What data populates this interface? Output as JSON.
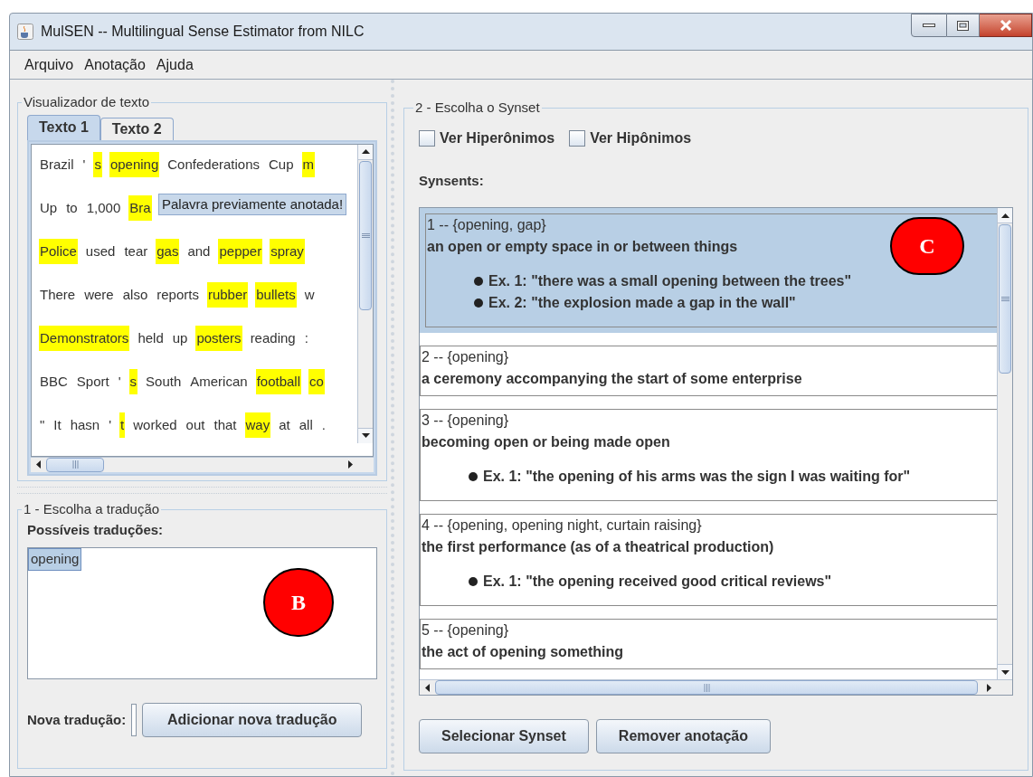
{
  "window": {
    "title": "MulSEN -- Multilingual Sense Estimator from NILC"
  },
  "menu": [
    "Arquivo",
    "Anotação",
    "Ajuda"
  ],
  "text_viewer": {
    "title": "Visualizador de texto",
    "tabs": [
      {
        "label": "Texto 1",
        "selected": true
      },
      {
        "label": "Texto 2",
        "selected": false
      }
    ],
    "lines": [
      {
        "tokens": [
          {
            "text": "Brazil",
            "highlighted": false
          },
          {
            "text": "'",
            "highlighted": false
          },
          {
            "text": "s",
            "highlighted": true
          },
          {
            "text": "opening",
            "highlighted": true
          },
          {
            "text": "Confederations",
            "highlighted": false
          },
          {
            "text": "Cup",
            "highlighted": false
          },
          {
            "text": "m",
            "highlighted": true
          }
        ]
      },
      {
        "tokens": [
          {
            "text": "Up",
            "highlighted": false
          },
          {
            "text": "to",
            "highlighted": false
          },
          {
            "text": "1,000",
            "highlighted": false
          },
          {
            "text": "Bra",
            "highlighted": true
          }
        ]
      },
      {
        "tokens": [
          {
            "text": "Police",
            "highlighted": true
          },
          {
            "text": "used",
            "highlighted": false
          },
          {
            "text": "tear",
            "highlighted": false
          },
          {
            "text": "gas",
            "highlighted": true
          },
          {
            "text": "and",
            "highlighted": false
          },
          {
            "text": "pepper",
            "highlighted": true
          },
          {
            "text": "spray",
            "highlighted": true
          }
        ]
      },
      {
        "tokens": [
          {
            "text": "There",
            "highlighted": false
          },
          {
            "text": "were",
            "highlighted": false
          },
          {
            "text": "also",
            "highlighted": false
          },
          {
            "text": "reports",
            "highlighted": false
          },
          {
            "text": "rubber",
            "highlighted": true
          },
          {
            "text": "bullets",
            "highlighted": true
          },
          {
            "text": "w",
            "highlighted": false
          }
        ]
      },
      {
        "tokens": [
          {
            "text": "Demonstrators",
            "highlighted": true
          },
          {
            "text": "held",
            "highlighted": false
          },
          {
            "text": "up",
            "highlighted": false
          },
          {
            "text": "posters",
            "highlighted": true
          },
          {
            "text": "reading",
            "highlighted": false
          },
          {
            "text": ":",
            "highlighted": false
          }
        ]
      },
      {
        "tokens": [
          {
            "text": "BBC",
            "highlighted": false
          },
          {
            "text": "Sport",
            "highlighted": false
          },
          {
            "text": "'",
            "highlighted": false
          },
          {
            "text": "s",
            "highlighted": true
          },
          {
            "text": "South",
            "highlighted": false
          },
          {
            "text": "American",
            "highlighted": false
          },
          {
            "text": "football",
            "highlighted": true
          },
          {
            "text": "co",
            "highlighted": true
          }
        ]
      },
      {
        "tokens": [
          {
            "text": "\"",
            "highlighted": false
          },
          {
            "text": "It",
            "highlighted": false
          },
          {
            "text": "hasn",
            "highlighted": false
          },
          {
            "text": "'",
            "highlighted": false
          },
          {
            "text": "t",
            "highlighted": true
          },
          {
            "text": "worked",
            "highlighted": false
          },
          {
            "text": "out",
            "highlighted": false
          },
          {
            "text": "that",
            "highlighted": false
          },
          {
            "text": "way",
            "highlighted": true
          },
          {
            "text": "at",
            "highlighted": false
          },
          {
            "text": "all",
            "highlighted": false
          },
          {
            "text": ".",
            "highlighted": false
          }
        ]
      }
    ],
    "tooltip": "Palavra previamente anotada!"
  },
  "translation": {
    "title": "1 - Escolha a tradução",
    "list_label": "Possíveis traduções:",
    "items": [
      {
        "text": "opening",
        "selected": true
      }
    ],
    "marker": "B",
    "new_label": "Nova tradução:",
    "add_button": "Adicionar nova tradução"
  },
  "synset": {
    "title": "2 - Escolha o Synset",
    "checkboxes": [
      {
        "label": "Ver Hiperônimos",
        "checked": false
      },
      {
        "label": "Ver Hipônimos",
        "checked": false
      }
    ],
    "list_label": "Synsents:",
    "marker": "C",
    "items": [
      {
        "header": "1 -- {opening, gap}",
        "gloss": "an open or empty space in or between things",
        "examples": [
          "Ex. 1: \"there was a small opening between the trees\"",
          "Ex. 2: \"the explosion made a gap in the wall\""
        ],
        "selected": true
      },
      {
        "header": "2 -- {opening}",
        "gloss": "a ceremony accompanying the start of some enterprise",
        "selected": false
      },
      {
        "header": "3 -- {opening}",
        "gloss": "becoming open or being made open",
        "examples": [
          "Ex. 1: \"the opening of his arms was the sign I was waiting for\""
        ],
        "selected": false
      },
      {
        "header": "4 -- {opening, opening night, curtain raising}",
        "gloss": "the first performance (as of a theatrical production)",
        "examples": [
          "Ex. 1: \"the opening received good critical reviews\""
        ],
        "selected": false
      },
      {
        "header": "5 -- {opening}",
        "gloss": "the act of opening something",
        "selected": false
      }
    ],
    "buttons": [
      "Selecionar Synset",
      "Remover anotação"
    ]
  }
}
